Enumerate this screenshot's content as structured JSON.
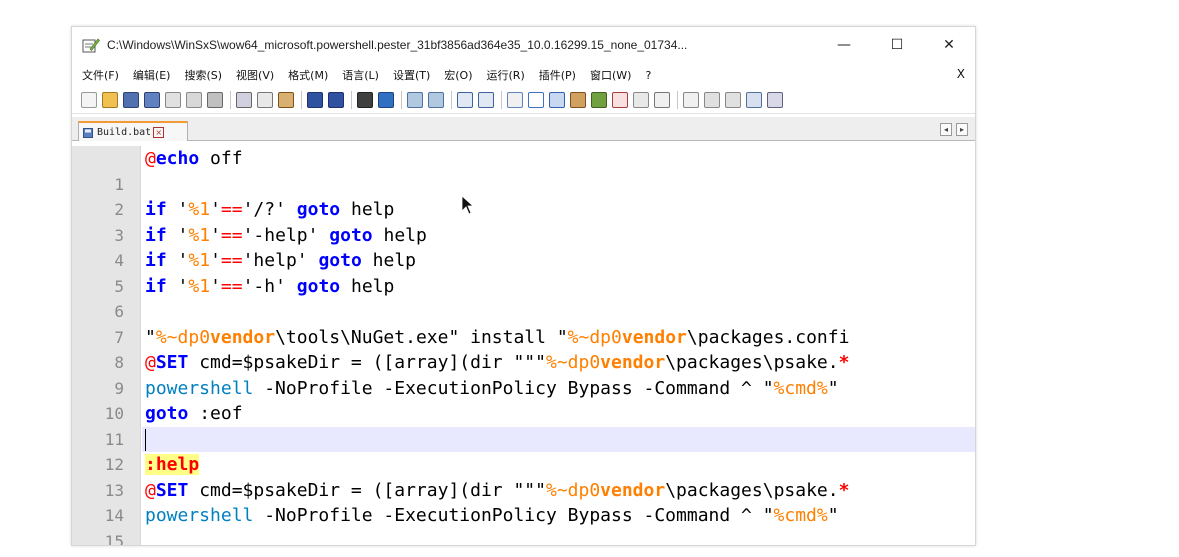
{
  "window": {
    "title": "C:\\Windows\\WinSxS\\wow64_microsoft.powershell.pester_31bf3856ad364e35_10.0.16299.15_none_01734...",
    "minimize_glyph": "—",
    "maximize_glyph": "☐",
    "close_glyph": "✕"
  },
  "menu": {
    "items": [
      "文件(F)",
      "编辑(E)",
      "搜索(S)",
      "视图(V)",
      "格式(M)",
      "语言(L)",
      "设置(T)",
      "宏(O)",
      "运行(R)",
      "插件(P)",
      "窗口(W)",
      "?"
    ],
    "close_glyph": "X"
  },
  "tabs": {
    "active_label": "Build.bat",
    "close_glyph": "×",
    "left_arrow": "◂",
    "right_arrow": "▸"
  },
  "editor": {
    "lines": [
      {
        "n": "1"
      },
      {
        "n": "2"
      },
      {
        "n": "3"
      },
      {
        "n": "4"
      },
      {
        "n": "5"
      },
      {
        "n": "6"
      },
      {
        "n": "7"
      },
      {
        "n": "8"
      },
      {
        "n": "9"
      },
      {
        "n": "10"
      },
      {
        "n": "11"
      },
      {
        "n": "12"
      },
      {
        "n": "13"
      },
      {
        "n": "14"
      },
      {
        "n": "15"
      }
    ],
    "tokens": {
      "l1_at": "@",
      "l1_echo": "echo",
      "l1_rest": " off",
      "if": "if",
      "q": "'",
      "pct1": "%1",
      "eqeq": "==",
      "goto": "goto",
      "help": " help",
      "l3_arg": "'/?'",
      "l4_arg": "'-help'",
      "l5_arg": "'help'",
      "l6_arg": "'-h'",
      "l8_a": "\"",
      "l8_var1": "%~dp0",
      "l8_b": "vendor",
      "l8_c": "\\tools\\NuGet.exe\" install \"",
      "l8_var2": "%~dp0",
      "l8_d": "vendor",
      "l8_e": "\\packages.confi",
      "l9_at": "@",
      "l9_set": "SET",
      "l9_a": " cmd=$psakeDir = ([array](dir \"\"\"",
      "l9_var": "%~dp0",
      "l9_b": "vendor",
      "l9_c": "\\packages\\psake.",
      "l9_star": "*",
      "ps": "powershell",
      "ps_rest": " -NoProfile -ExecutionPolicy Bypass -Command ^ \"",
      "cmdvar": "%cmd%",
      "dq": "\"",
      "l11_goto": "goto",
      "l11_rest": " :eof",
      "l13_label": ":help"
    }
  }
}
